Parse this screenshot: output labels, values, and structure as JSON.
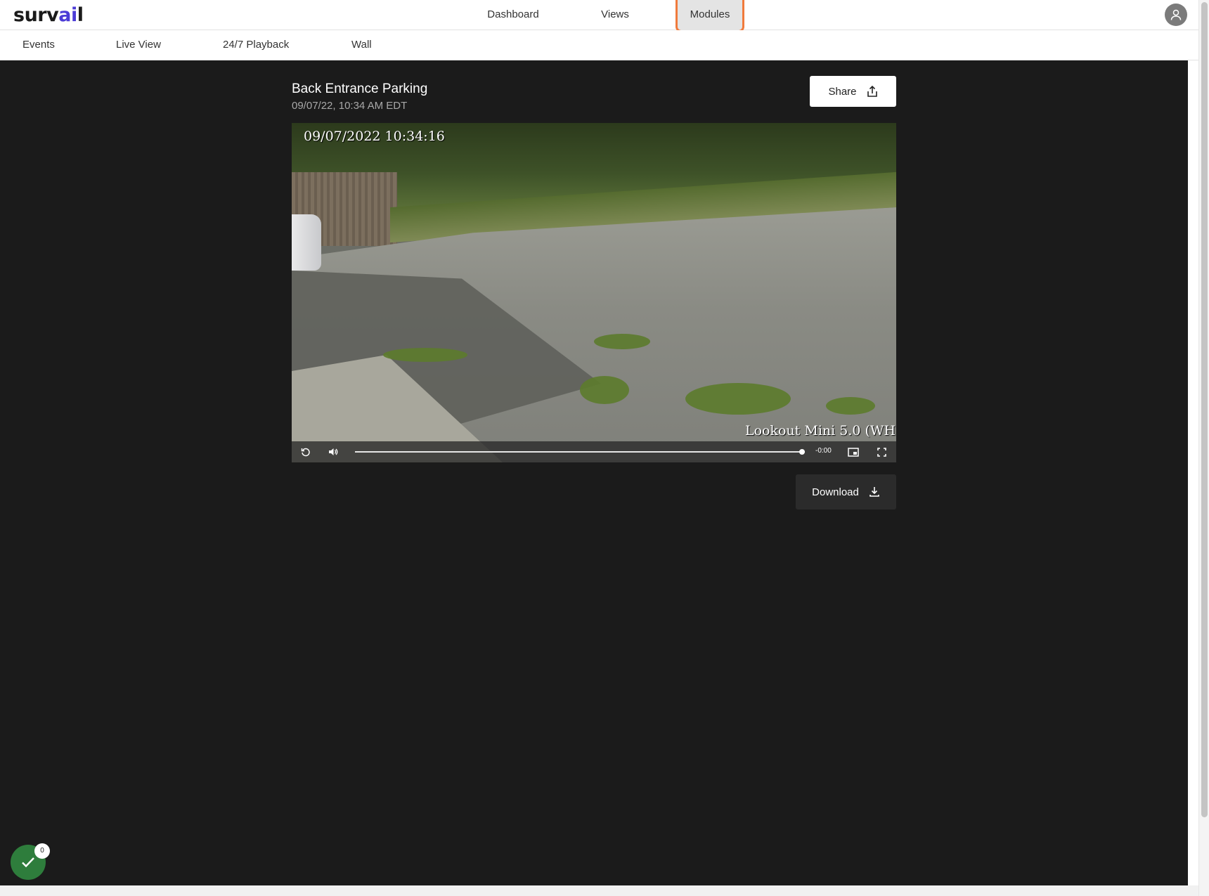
{
  "brand": {
    "logo_text": "surv",
    "logo_accent": "ai",
    "logo_end": "l",
    "accent_color": "#4b3bd6"
  },
  "main_nav": [
    {
      "label": "Dashboard"
    },
    {
      "label": "Views"
    },
    {
      "label": "Modules",
      "active": true
    }
  ],
  "user": {
    "icon": "user-avatar-icon"
  },
  "sub_nav": [
    {
      "label": "Events"
    },
    {
      "label": "Live View"
    },
    {
      "label": "24/7 Playback"
    },
    {
      "label": "Wall"
    }
  ],
  "camera": {
    "title": "Back Entrance Parking",
    "timestamp": "09/07/22, 10:34 AM EDT",
    "share_label": "Share",
    "download_label": "Download"
  },
  "video": {
    "osd_time": "09/07/2022 10:34:16",
    "osd_model": "Lookout Mini 5.0 (WH",
    "remaining_time": "-0:00",
    "progress_fraction": 1.0
  },
  "status": {
    "count": "0",
    "color": "#2e7d3c",
    "icon": "check-icon"
  },
  "highlight_color": "#f07a3c"
}
